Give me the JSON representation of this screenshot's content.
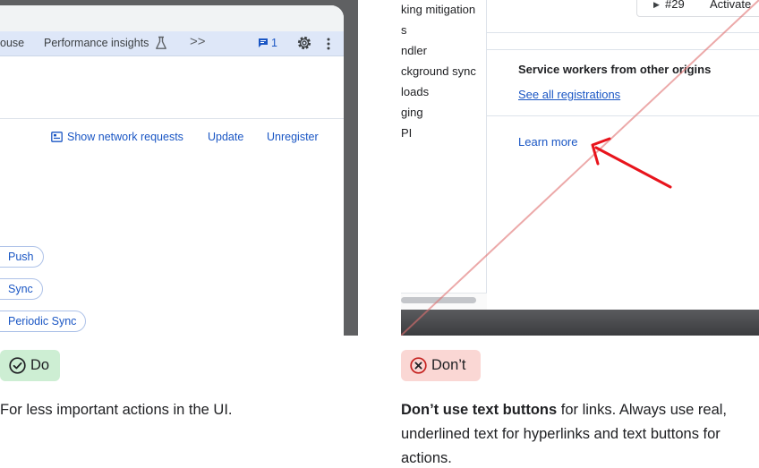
{
  "do_panel": {
    "toolbar": {
      "tab_partial": "ouse",
      "tab_performance": "Performance insights",
      "more_tabs": ">>",
      "issues_count": "1"
    },
    "actions": {
      "show_network": "Show network requests",
      "update": "Update",
      "unregister": "Unregister"
    },
    "chips": [
      "Push",
      "Sync",
      "Periodic Sync"
    ],
    "badge": "Do",
    "caption": "For less important actions in the UI."
  },
  "dont_panel": {
    "sidebar_items": [
      "king mitigation",
      "s",
      "ndler",
      "ckground sync",
      "loads",
      "ging",
      "PI"
    ],
    "tab_number": "#29",
    "tab_status": "Activate",
    "heading": "Service workers from other origins",
    "see_all_link": "See all registrations",
    "learn_more": "Learn more",
    "badge": "Don’t",
    "caption_bold": "Don’t use text buttons",
    "caption_rest": " for links. Always use real, underlined text for hyperlinks and text buttons for actions."
  },
  "colors": {
    "link_blue": "#1a56c4",
    "do_green": "#cdeed3",
    "dont_red": "#fad7d4",
    "arrow_red": "#e8141c"
  },
  "icons": [
    "experiment-flask-icon",
    "chevron-double-right-icon",
    "message-icon",
    "gear-icon",
    "kebab-menu-icon",
    "network-list-icon",
    "check-circle-icon",
    "x-circle-icon",
    "red-arrow-annotation"
  ]
}
